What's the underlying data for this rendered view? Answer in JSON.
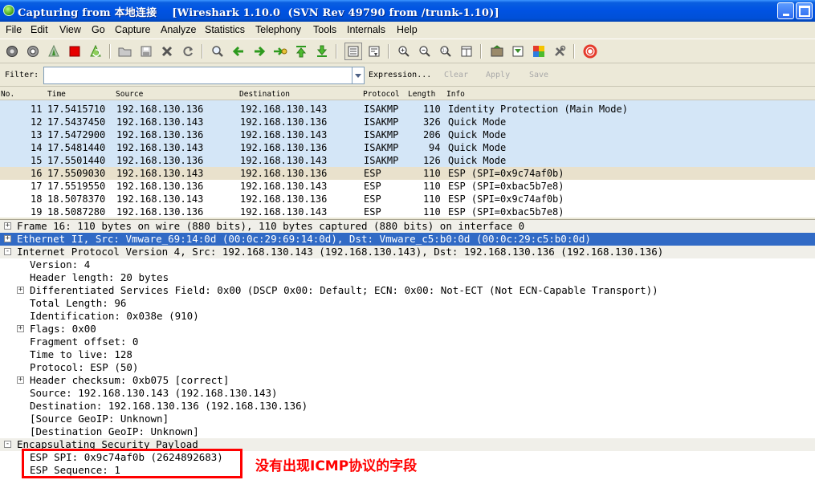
{
  "window": {
    "title": "Capturing from 本地连接    [Wireshark 1.10.0  (SVN Rev 49790 from /trunk-1.10)]"
  },
  "menu": [
    "File",
    "Edit",
    "View",
    "Go",
    "Capture",
    "Analyze",
    "Statistics",
    "Telephony",
    "Tools",
    "Internals",
    "Help"
  ],
  "filter": {
    "label": "Filter:",
    "value": "",
    "expression": "Expression...",
    "clear": "Clear",
    "apply": "Apply",
    "save": "Save"
  },
  "packet_list": {
    "columns": [
      "No.",
      "Time",
      "Source",
      "Destination",
      "Protocol",
      "Length",
      "Info"
    ],
    "rows": [
      {
        "no": "11",
        "time": "17.5415710",
        "src": "192.168.130.136",
        "dst": "192.168.130.143",
        "proto": "ISAKMP",
        "len": "110",
        "info": "Identity Protection (Main Mode)"
      },
      {
        "no": "12",
        "time": "17.5437450",
        "src": "192.168.130.143",
        "dst": "192.168.130.136",
        "proto": "ISAKMP",
        "len": "326",
        "info": "Quick Mode"
      },
      {
        "no": "13",
        "time": "17.5472900",
        "src": "192.168.130.136",
        "dst": "192.168.130.143",
        "proto": "ISAKMP",
        "len": "206",
        "info": "Quick Mode"
      },
      {
        "no": "14",
        "time": "17.5481440",
        "src": "192.168.130.143",
        "dst": "192.168.130.136",
        "proto": "ISAKMP",
        "len": "94",
        "info": "Quick Mode"
      },
      {
        "no": "15",
        "time": "17.5501440",
        "src": "192.168.130.136",
        "dst": "192.168.130.143",
        "proto": "ISAKMP",
        "len": "126",
        "info": "Quick Mode"
      },
      {
        "no": "16",
        "time": "17.5509030",
        "src": "192.168.130.143",
        "dst": "192.168.130.136",
        "proto": "ESP",
        "len": "110",
        "info": "ESP (SPI=0x9c74af0b)"
      },
      {
        "no": "17",
        "time": "17.5519550",
        "src": "192.168.130.136",
        "dst": "192.168.130.143",
        "proto": "ESP",
        "len": "110",
        "info": "ESP (SPI=0xbac5b7e8)"
      },
      {
        "no": "18",
        "time": "18.5078370",
        "src": "192.168.130.143",
        "dst": "192.168.130.136",
        "proto": "ESP",
        "len": "110",
        "info": "ESP (SPI=0x9c74af0b)"
      },
      {
        "no": "19",
        "time": "18.5087280",
        "src": "192.168.130.136",
        "dst": "192.168.130.143",
        "proto": "ESP",
        "len": "110",
        "info": "ESP (SPI=0xbac5b7e8)"
      }
    ]
  },
  "details": [
    {
      "text": "Frame 16: 110 bytes on wire (880 bits), 110 bytes captured (880 bits) on interface 0",
      "level": 0,
      "expander": "+"
    },
    {
      "text": "Ethernet II, Src: Vmware_69:14:0d (00:0c:29:69:14:0d), Dst: Vmware_c5:b0:0d (00:0c:29:c5:b0:0d)",
      "level": 0,
      "expander": "+"
    },
    {
      "text": "Internet Protocol Version 4, Src: 192.168.130.143 (192.168.130.143), Dst: 192.168.130.136 (192.168.130.136)",
      "level": 0,
      "expander": "-"
    },
    {
      "text": "Version: 4",
      "level": 1,
      "expander": ""
    },
    {
      "text": "Header length: 20 bytes",
      "level": 1,
      "expander": ""
    },
    {
      "text": "Differentiated Services Field: 0x00 (DSCP 0x00: Default; ECN: 0x00: Not-ECT (Not ECN-Capable Transport))",
      "level": 1,
      "expander": "+"
    },
    {
      "text": "Total Length: 96",
      "level": 1,
      "expander": ""
    },
    {
      "text": "Identification: 0x038e (910)",
      "level": 1,
      "expander": ""
    },
    {
      "text": "Flags: 0x00",
      "level": 1,
      "expander": "+"
    },
    {
      "text": "Fragment offset: 0",
      "level": 1,
      "expander": ""
    },
    {
      "text": "Time to live: 128",
      "level": 1,
      "expander": ""
    },
    {
      "text": "Protocol: ESP (50)",
      "level": 1,
      "expander": ""
    },
    {
      "text": "Header checksum: 0xb075 [correct]",
      "level": 1,
      "expander": "+"
    },
    {
      "text": "Source: 192.168.130.143 (192.168.130.143)",
      "level": 1,
      "expander": ""
    },
    {
      "text": "Destination: 192.168.130.136 (192.168.130.136)",
      "level": 1,
      "expander": ""
    },
    {
      "text": "[Source GeoIP: Unknown]",
      "level": 1,
      "expander": ""
    },
    {
      "text": "[Destination GeoIP: Unknown]",
      "level": 1,
      "expander": ""
    },
    {
      "text": "Encapsulating Security Payload",
      "level": 0,
      "expander": "-"
    },
    {
      "text": "ESP SPI: 0x9c74af0b (2624892683)",
      "level": 1,
      "expander": ""
    },
    {
      "text": "ESP Sequence: 1",
      "level": 1,
      "expander": ""
    }
  ],
  "annotation": "没有出现ICMP协议的字段",
  "colors": {
    "isakmp_row": "#d4e6f7",
    "selected_row": "#e9e1cc",
    "highlight": "#316ac5",
    "annotation": "#ff0000"
  }
}
